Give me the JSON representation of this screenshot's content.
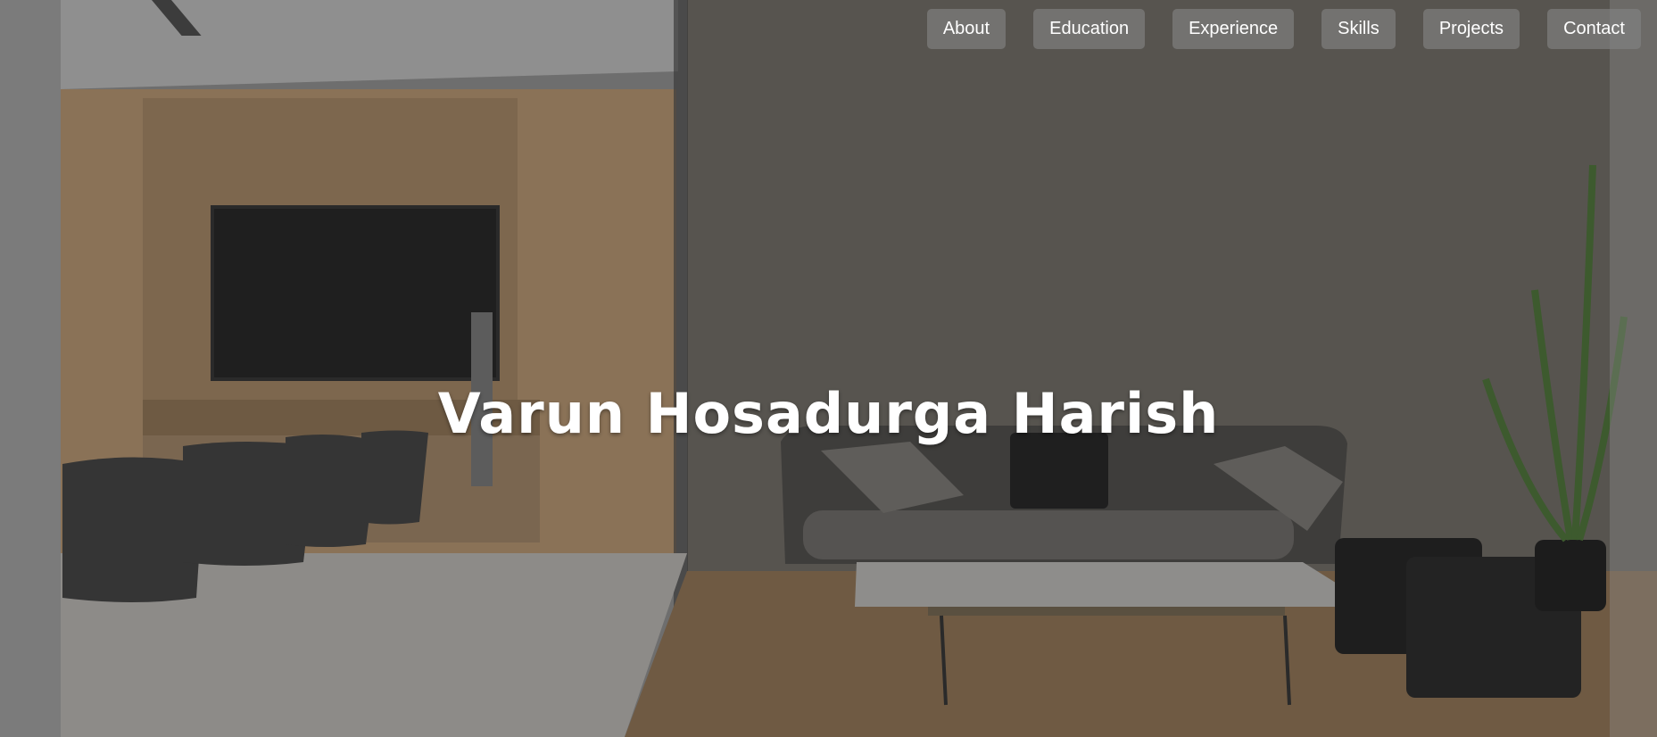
{
  "nav": {
    "items": [
      {
        "label": "About"
      },
      {
        "label": "Education"
      },
      {
        "label": "Experience"
      },
      {
        "label": "Skills"
      },
      {
        "label": "Projects"
      },
      {
        "label": "Contact"
      }
    ]
  },
  "hero": {
    "title": "Varun Hosadurga Harish"
  },
  "colors": {
    "nav_bg": "#8a8a8a",
    "title_text": "#ffffff",
    "overlay": "#5a5957"
  }
}
